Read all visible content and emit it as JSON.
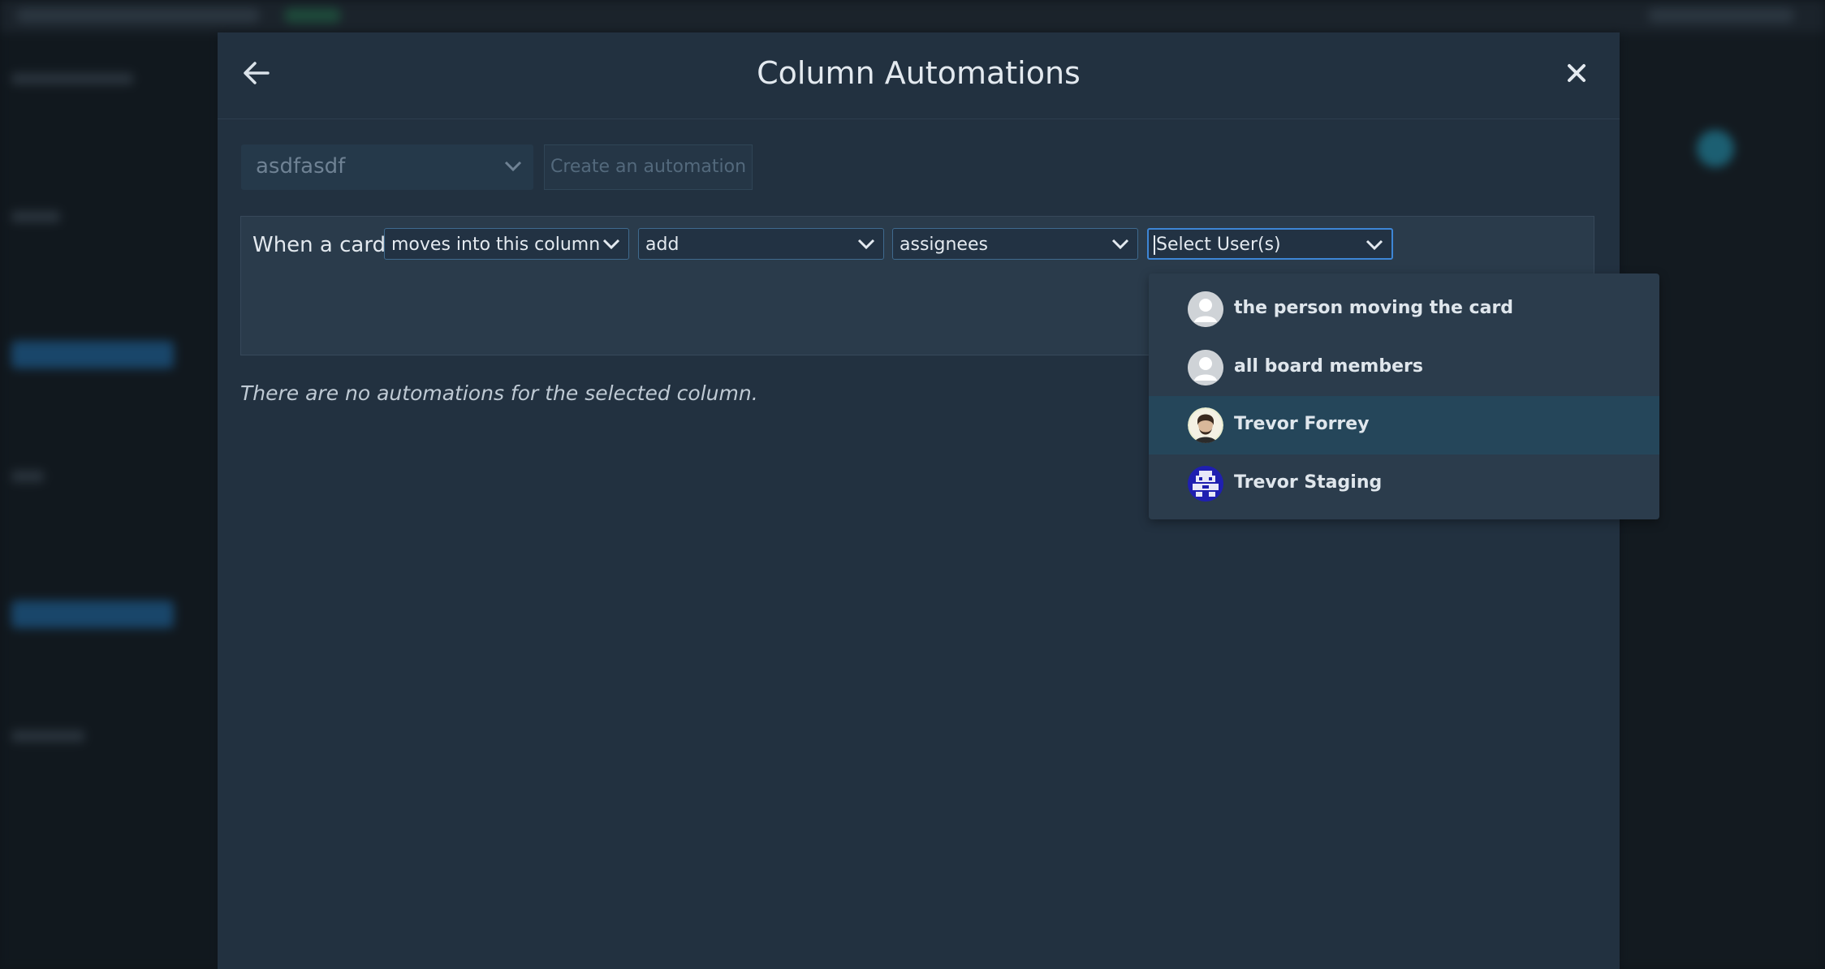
{
  "modal": {
    "title": "Column Automations"
  },
  "toolbar": {
    "column_value": "asdfasdf",
    "create_label": "Create an automation"
  },
  "rule": {
    "prefix": "When a card",
    "trigger": "moves into this column",
    "action": "add",
    "field": "assignees",
    "users_placeholder": "Select User(s)"
  },
  "empty_message": "There are no automations for the selected column.",
  "dropdown": {
    "options": [
      {
        "label": "the person moving the card",
        "avatar": "default-user-icon"
      },
      {
        "label": "all board members",
        "avatar": "default-user-icon"
      },
      {
        "label": "Trevor Forrey",
        "avatar": "photo-avatar",
        "highlighted": true
      },
      {
        "label": "Trevor Staging",
        "avatar": "pixel-avatar"
      }
    ]
  },
  "colors": {
    "modal_bg": "#223140",
    "accent_border": "#3d86d6",
    "highlight": "#25465a"
  }
}
